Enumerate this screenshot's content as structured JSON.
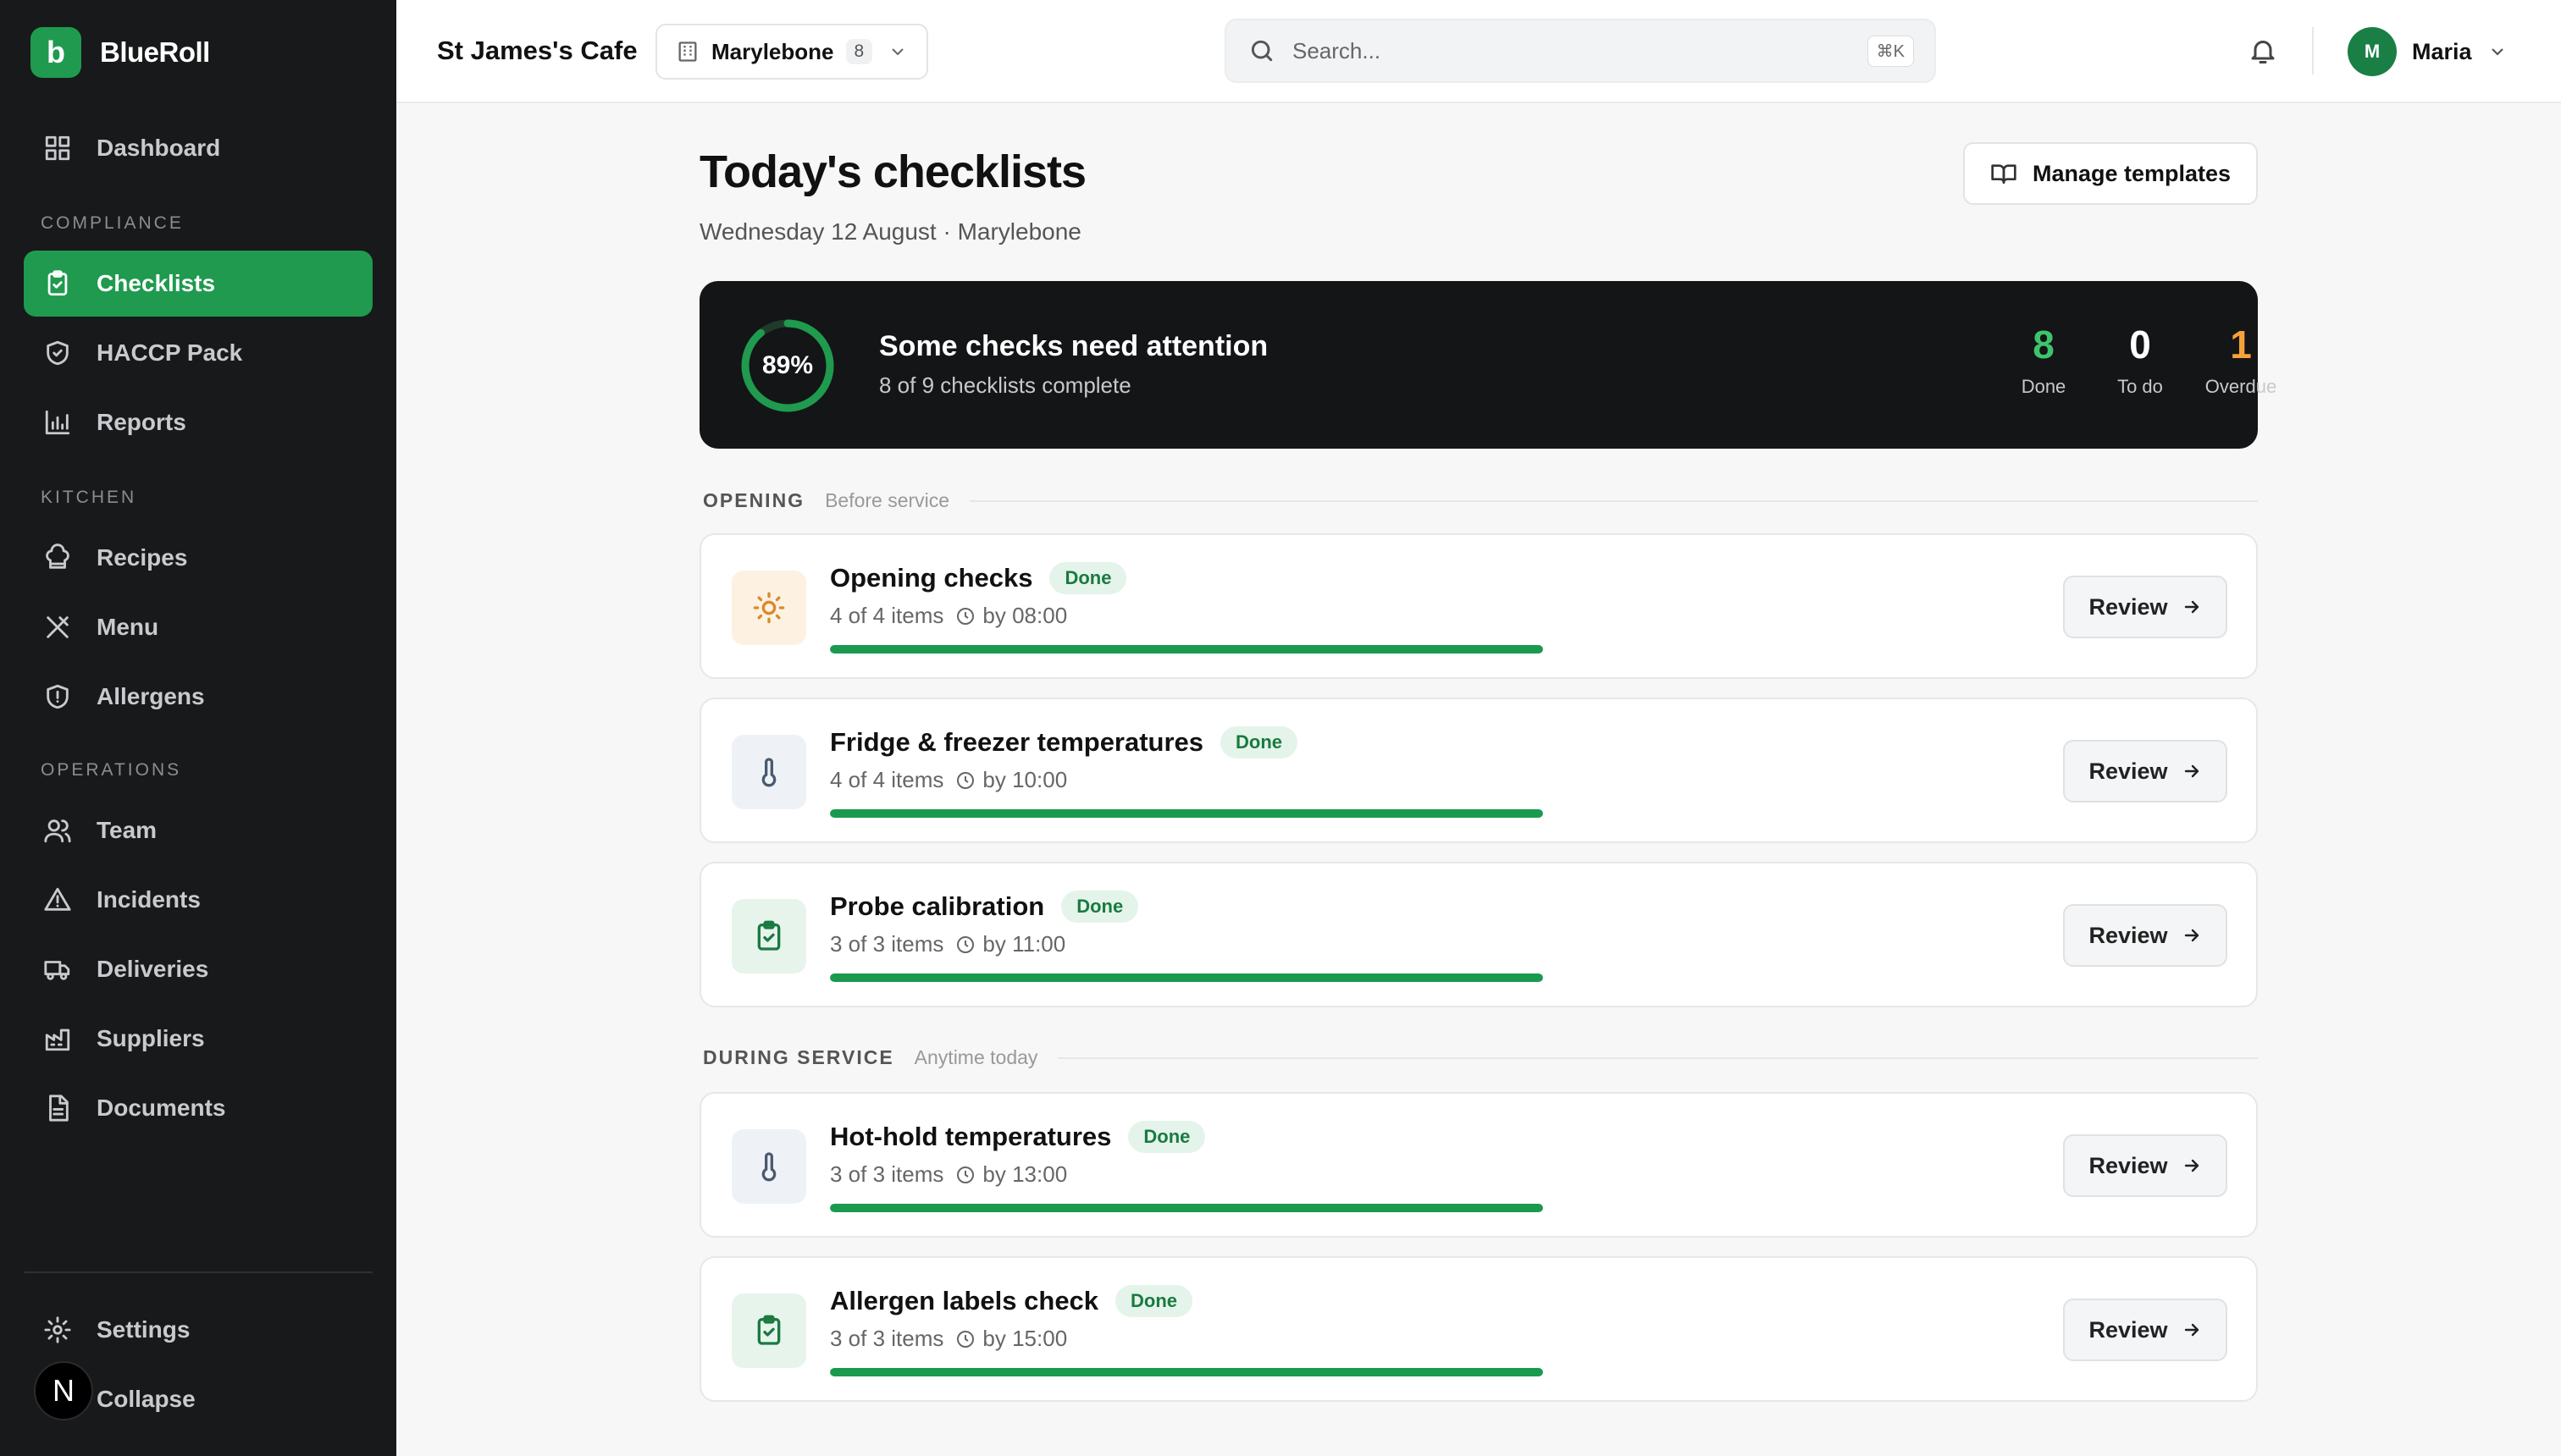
{
  "brand": {
    "logo_letter": "b",
    "name": "BlueRoll"
  },
  "sidebar": {
    "top": [
      {
        "label": "Dashboard",
        "icon": "grid-icon"
      }
    ],
    "sections": [
      {
        "title": "COMPLIANCE",
        "items": [
          {
            "label": "Checklists",
            "icon": "clipboard-check-icon",
            "active": true
          },
          {
            "label": "HACCP Pack",
            "icon": "shield-check-icon"
          },
          {
            "label": "Reports",
            "icon": "bar-chart-icon"
          }
        ]
      },
      {
        "title": "KITCHEN",
        "items": [
          {
            "label": "Recipes",
            "icon": "chef-hat-icon"
          },
          {
            "label": "Menu",
            "icon": "utensils-icon"
          },
          {
            "label": "Allergens",
            "icon": "shield-alert-icon"
          }
        ]
      },
      {
        "title": "OPERATIONS",
        "items": [
          {
            "label": "Team",
            "icon": "users-icon"
          },
          {
            "label": "Incidents",
            "icon": "warning-triangle-icon"
          },
          {
            "label": "Deliveries",
            "icon": "truck-icon"
          },
          {
            "label": "Suppliers",
            "icon": "factory-icon"
          },
          {
            "label": "Documents",
            "icon": "document-icon"
          }
        ]
      }
    ],
    "bottom": [
      {
        "label": "Settings",
        "icon": "gear-icon"
      },
      {
        "label": "Collapse",
        "icon": "collapse-icon"
      }
    ],
    "overlay_badge": "N"
  },
  "header": {
    "cafe_name": "St James's Cafe",
    "location": {
      "name": "Marylebone",
      "count": "8"
    },
    "search": {
      "placeholder": "Search...",
      "shortcut": "⌘K"
    },
    "user": {
      "initial": "M",
      "name": "Maria"
    }
  },
  "main": {
    "title": "Today's checklists",
    "subtitle": "Wednesday 12 August · Marylebone",
    "manage_label": "Manage templates",
    "summary": {
      "percent_label": "89%",
      "percent": 89,
      "title": "Some checks need attention",
      "subtitle": "8 of 9 checklists complete",
      "stats": [
        {
          "value": "8",
          "label": "Done",
          "color": "#3ec46d"
        },
        {
          "value": "0",
          "label": "To do",
          "color": "#ffffff"
        },
        {
          "value": "1",
          "label": "Overdue",
          "color": "#f5a23a"
        }
      ]
    },
    "sections": [
      {
        "name": "OPENING",
        "desc": "Before service",
        "cards": [
          {
            "title": "Opening checks",
            "status": "Done",
            "items": "4 of 4 items",
            "due": "by 08:00",
            "progress": 1.0,
            "icon": "sun-icon",
            "icon_bg": "#fdf1e2",
            "icon_color": "#d98a2b"
          },
          {
            "title": "Fridge & freezer temperatures",
            "status": "Done",
            "items": "4 of 4 items",
            "due": "by 10:00",
            "progress": 1.0,
            "icon": "thermometer-icon",
            "icon_bg": "#eef2f6",
            "icon_color": "#4a5a6e"
          },
          {
            "title": "Probe calibration",
            "status": "Done",
            "items": "3 of 3 items",
            "due": "by 11:00",
            "progress": 1.0,
            "icon": "clipboard-check-icon",
            "icon_bg": "#e7f4ec",
            "icon_color": "#1a7a40"
          }
        ]
      },
      {
        "name": "DURING SERVICE",
        "desc": "Anytime today",
        "cards": [
          {
            "title": "Hot-hold temperatures",
            "status": "Done",
            "items": "3 of 3 items",
            "due": "by 13:00",
            "progress": 1.0,
            "icon": "thermometer-icon",
            "icon_bg": "#eef2f6",
            "icon_color": "#4a5a6e"
          },
          {
            "title": "Allergen labels check",
            "status": "Done",
            "items": "3 of 3 items",
            "due": "by 15:00",
            "progress": 1.0,
            "icon": "clipboard-check-icon",
            "icon_bg": "#e7f4ec",
            "icon_color": "#1a7a40"
          }
        ]
      }
    ],
    "review_label": "Review"
  }
}
